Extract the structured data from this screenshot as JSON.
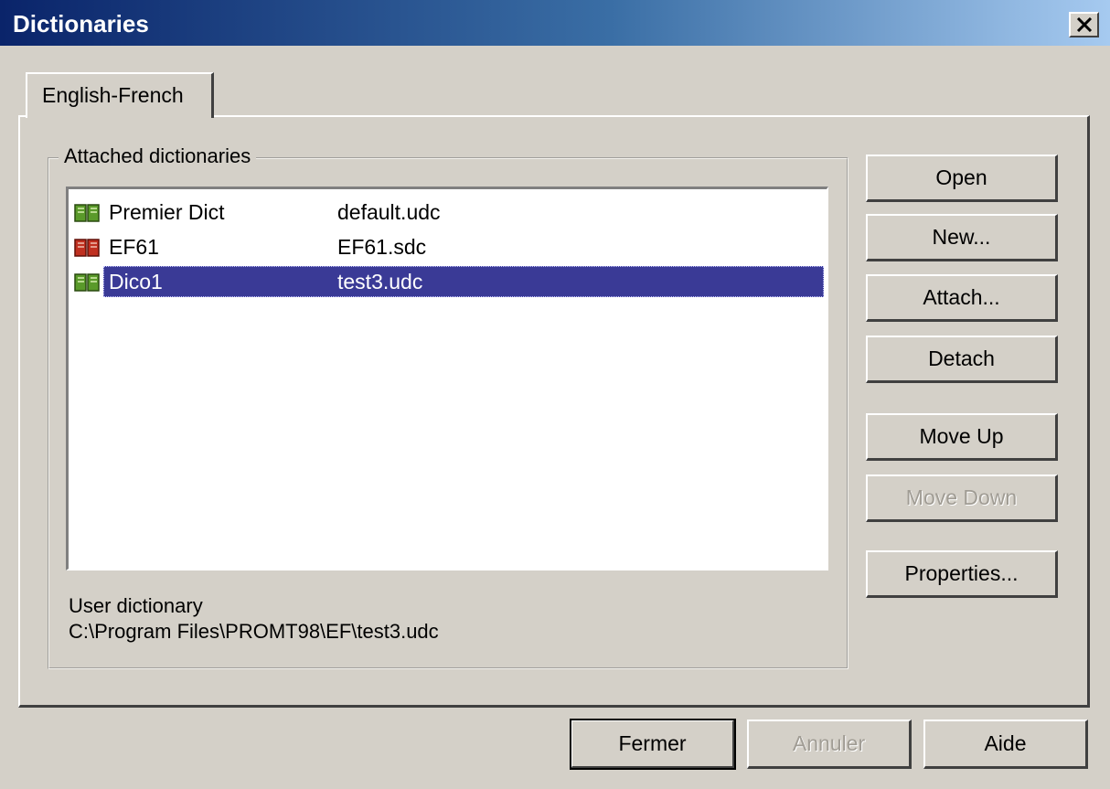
{
  "window": {
    "title": "Dictionaries"
  },
  "tab": {
    "label": "English-French"
  },
  "group": {
    "label": "Attached dictionaries"
  },
  "dictionaries": [
    {
      "name": "Premier Dict",
      "file": "default.udc",
      "icon": "book-green-icon",
      "selected": false
    },
    {
      "name": "EF61",
      "file": "EF61.sdc",
      "icon": "book-red-icon",
      "selected": false
    },
    {
      "name": "Dico1",
      "file": "test3.udc",
      "icon": "book-green-icon",
      "selected": true
    }
  ],
  "user_dictionary": {
    "label": "User dictionary",
    "path": "C:\\Program Files\\PROMT98\\EF\\test3.udc"
  },
  "buttons": {
    "open": "Open",
    "new": "New...",
    "attach": "Attach...",
    "detach": "Detach",
    "move_up": "Move Up",
    "move_down": "Move Down",
    "properties": "Properties...",
    "fermer": "Fermer",
    "annuler": "Annuler",
    "aide": "Aide"
  },
  "colors": {
    "dialog_bg": "#d4d0c8",
    "selection": "#3a3a96",
    "icon_green": "#5a9a2a",
    "icon_red": "#c03020"
  }
}
